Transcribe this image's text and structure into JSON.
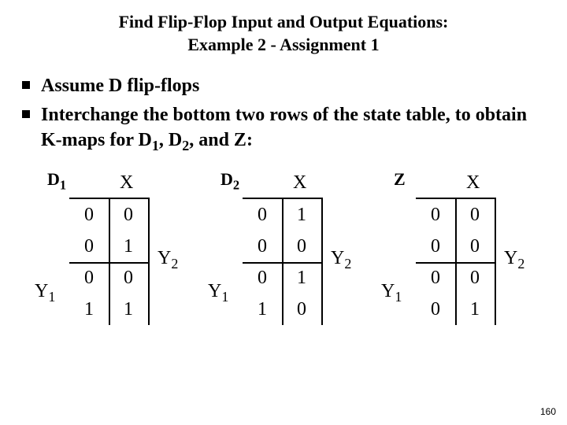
{
  "title_line1": "Find Flip-Flop Input and Output Equations:",
  "title_line2": "Example 2 - Assignment 1",
  "bullets": [
    "Assume D flip-flops",
    "Interchange the bottom two rows of the state table, to obtain K-maps for D"
  ],
  "bullet2_tail": ", and Z:",
  "sub1": "1",
  "sub2": "2",
  "Dlabel": "D",
  "labels": {
    "X": "X",
    "Y1": "Y",
    "Y1_sub": "1",
    "Y2": "Y",
    "Y2_sub": "2",
    "Z": "Z"
  },
  "kmaps": [
    {
      "name": "D",
      "name_sub": "1",
      "cells": [
        "0",
        "0",
        "0",
        "1",
        "0",
        "0",
        "1",
        "1"
      ]
    },
    {
      "name": "D",
      "name_sub": "2",
      "cells": [
        "0",
        "1",
        "0",
        "0",
        "0",
        "1",
        "1",
        "0"
      ]
    },
    {
      "name": "Z",
      "name_sub": "",
      "cells": [
        "0",
        "0",
        "0",
        "0",
        "0",
        "0",
        "0",
        "1"
      ]
    }
  ],
  "pagenum": "160",
  "chart_data": [
    {
      "type": "table",
      "title": "D1 K-map",
      "xlabel": "X",
      "ylabel": "Y1,Y2",
      "rows": [
        [
          "0",
          "0"
        ],
        [
          "0",
          "1"
        ],
        [
          "0",
          "0"
        ],
        [
          "1",
          "1"
        ]
      ]
    },
    {
      "type": "table",
      "title": "D2 K-map",
      "xlabel": "X",
      "ylabel": "Y1,Y2",
      "rows": [
        [
          "0",
          "1"
        ],
        [
          "0",
          "0"
        ],
        [
          "0",
          "1"
        ],
        [
          "1",
          "0"
        ]
      ]
    },
    {
      "type": "table",
      "title": "Z K-map",
      "xlabel": "X",
      "ylabel": "Y1,Y2",
      "rows": [
        [
          "0",
          "0"
        ],
        [
          "0",
          "0"
        ],
        [
          "0",
          "0"
        ],
        [
          "0",
          "1"
        ]
      ]
    }
  ]
}
